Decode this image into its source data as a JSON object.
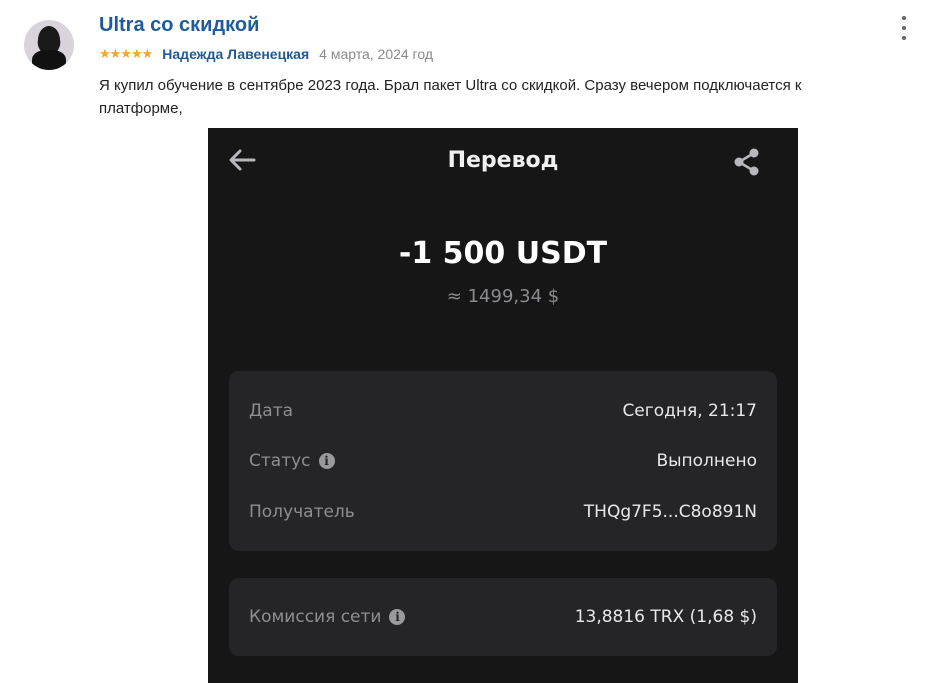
{
  "review": {
    "title": "Ultra со скидкой",
    "stars": "★★★★★",
    "author": "Надежда Лавенецкая",
    "date": "4 марта, 2024 год",
    "text": "Я купил обучение в сентябре 2023 года. Брал пакет Ultra со скидкой. Сразу вечером подключается к платформе,"
  },
  "screen": {
    "title": "Перевод",
    "amount": "-1 500 USDT",
    "amount_usd": "≈ 1499,34 $",
    "details": [
      {
        "label": "Дата",
        "value": "Сегодня, 21:17"
      },
      {
        "label": "Статус",
        "value": "Выполнено"
      },
      {
        "label": "Получатель",
        "value": "THQg7F5...C8o891N"
      }
    ],
    "fee": {
      "label": "Комиссия сети",
      "value": "13,8816 TRX (1,68 $)"
    }
  },
  "colors": {
    "link_blue": "#1f5b9a",
    "star": "#f5a623",
    "screen_bg": "#161617",
    "card_bg": "#252528"
  },
  "icons": [
    "more-vertical-icon",
    "back-arrow-icon",
    "share-icon",
    "info-icon"
  ]
}
